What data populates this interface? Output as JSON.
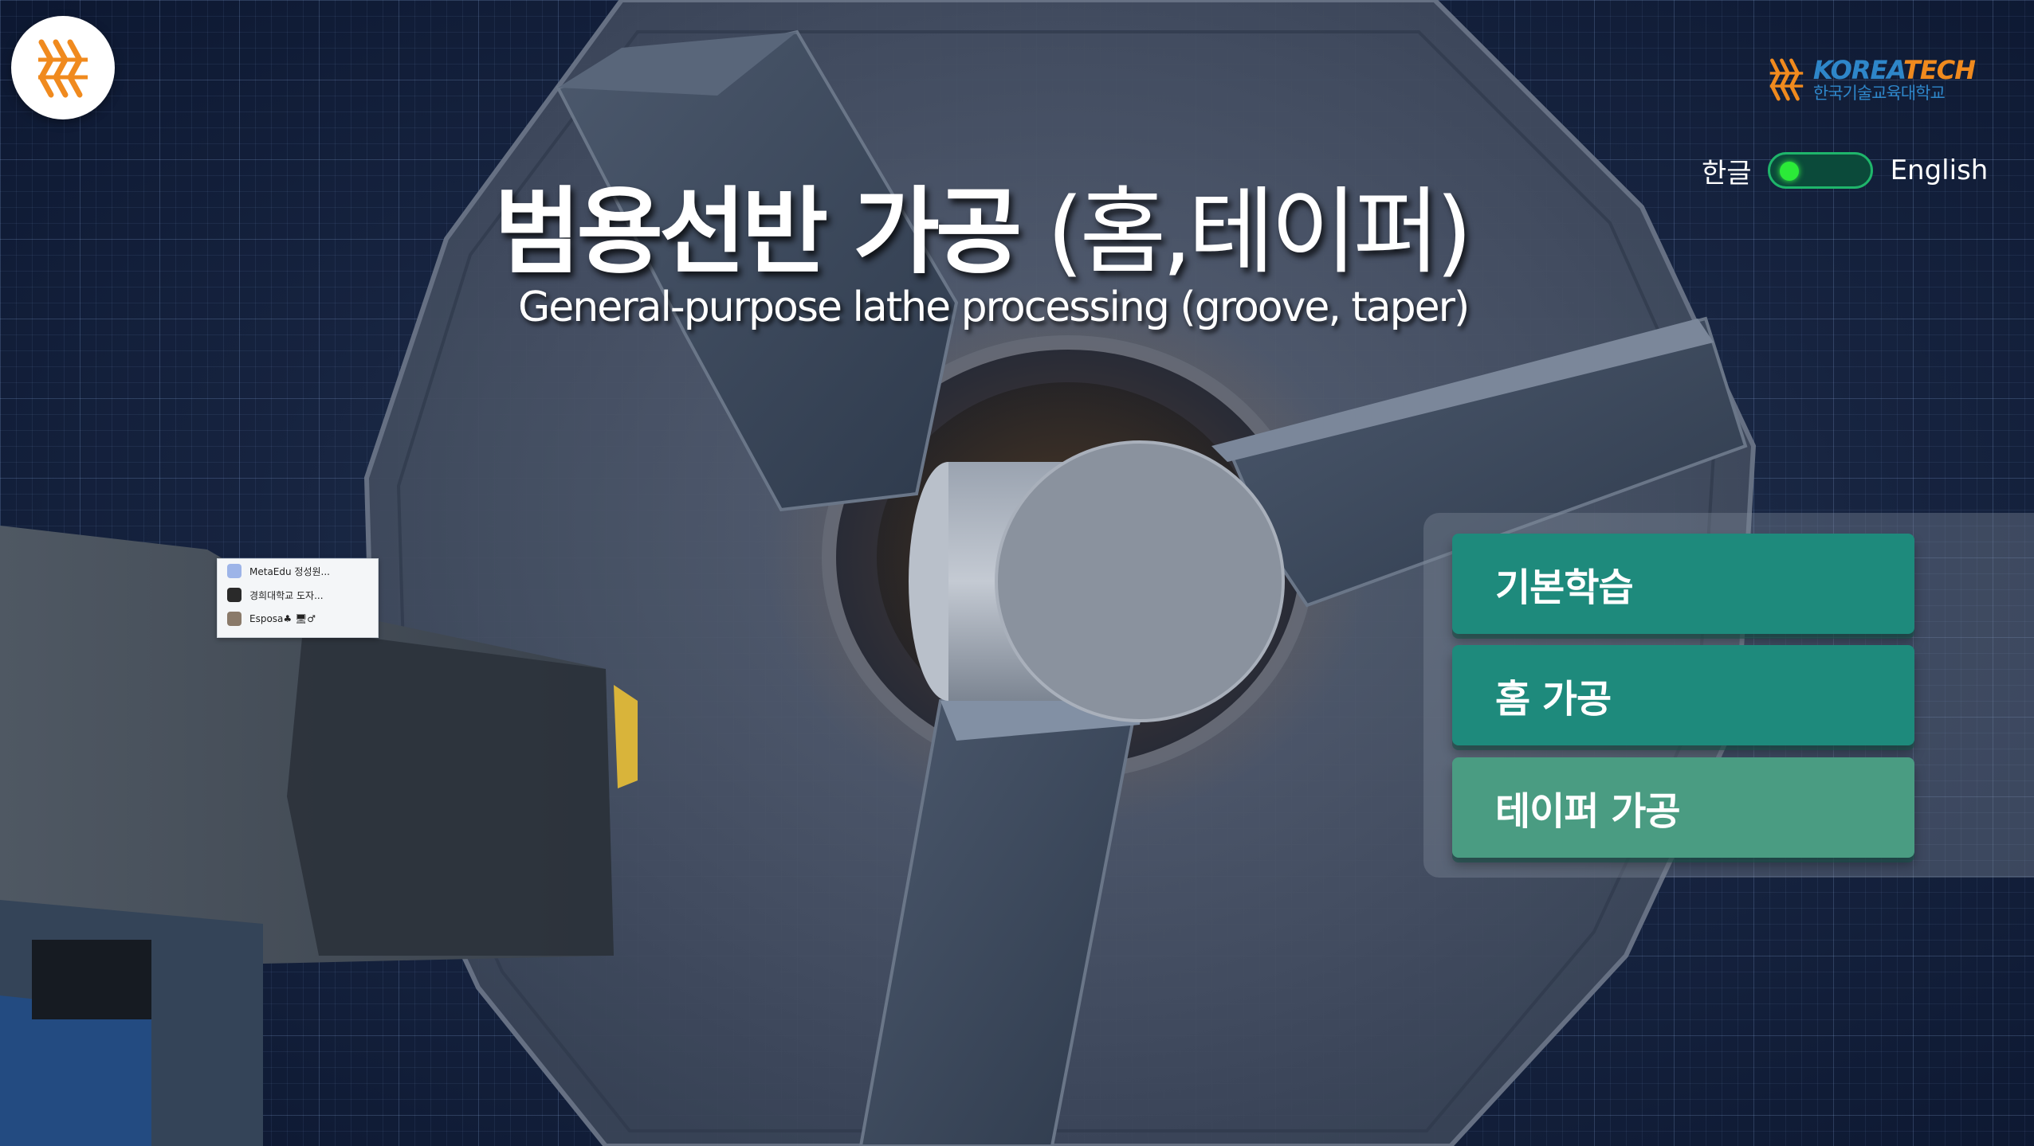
{
  "header": {
    "title_ko": "범용선반 가공",
    "title_ko_paren": "(홈,테이퍼)",
    "title_en": "General-purpose lathe processing (groove, taper)"
  },
  "brand": {
    "name_en_1": "KOREA",
    "name_en_2": "TECH",
    "name_ko": "한국기술교육대학교",
    "primary_color": "#2e86c9",
    "accent_color": "#f08a1e"
  },
  "language_toggle": {
    "left_label": "한글",
    "right_label": "English",
    "state": "한글"
  },
  "menu": {
    "items": [
      {
        "label": "기본학습",
        "color": "#1e8a7c"
      },
      {
        "label": "홈 가공",
        "color": "#1e8a7c"
      },
      {
        "label": "테이퍼 가공",
        "color": "#4a9c82"
      }
    ]
  },
  "mini_popup": {
    "items": [
      {
        "label": "MetaEdu 정성원...",
        "icon": "app-icon"
      },
      {
        "label": "경희대학교 도자...",
        "icon": "app-icon"
      },
      {
        "label": "Esposa♣ 🖥♂",
        "icon": "avatar-icon"
      }
    ]
  }
}
